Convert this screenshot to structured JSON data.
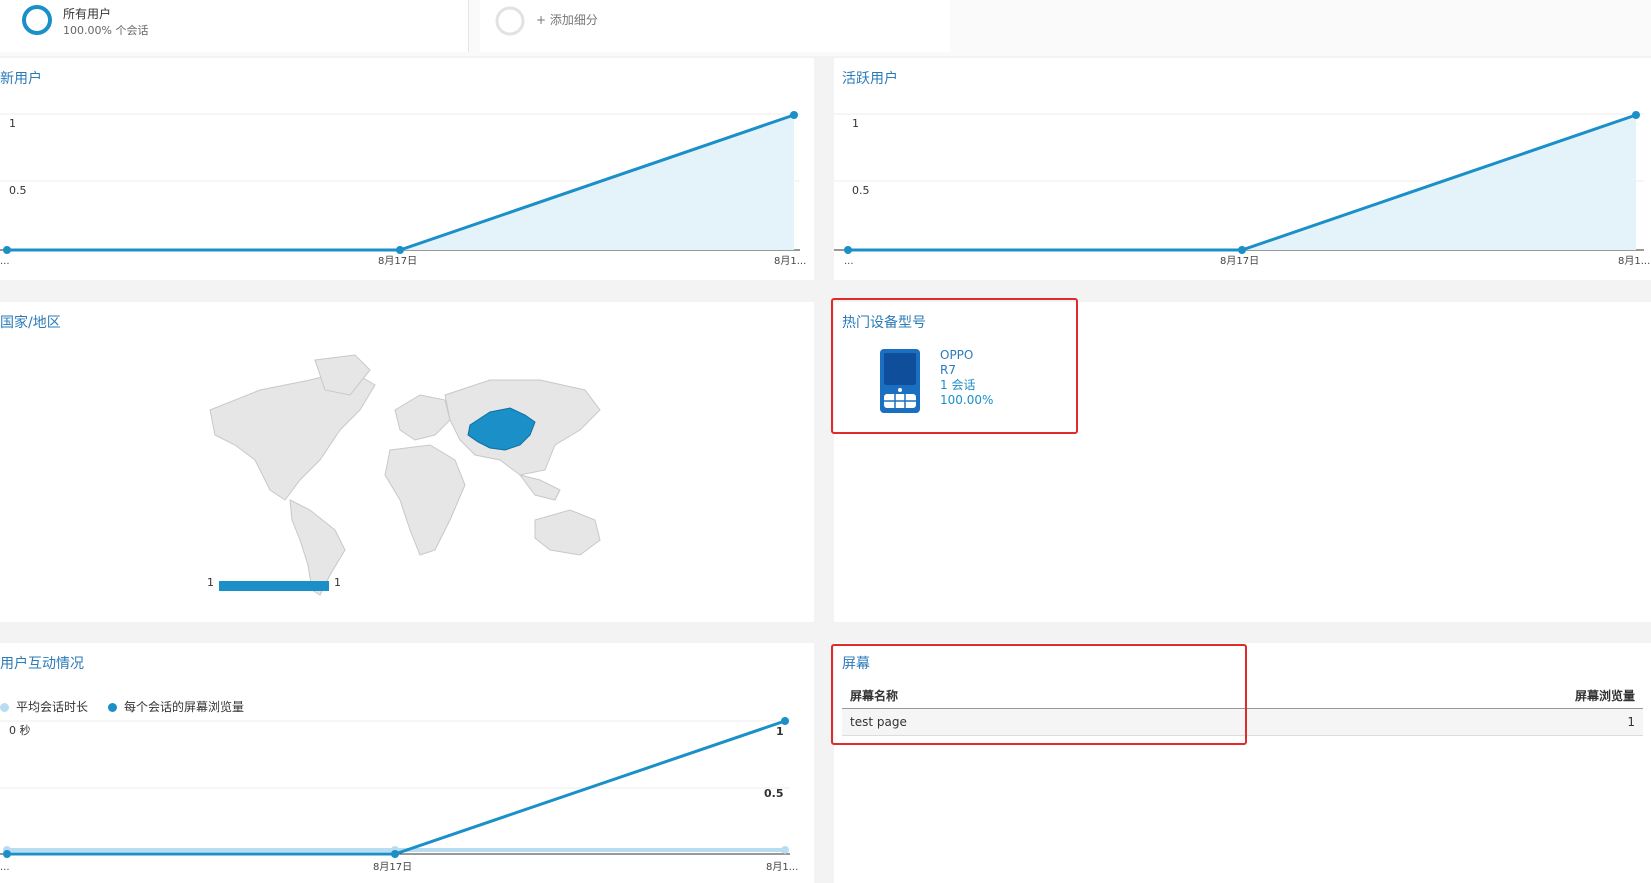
{
  "segment_bar": {
    "all_users_title": "所有用户",
    "all_users_sub": "100.00% 个会话",
    "add_segment": "+ 添加细分"
  },
  "colors": {
    "accent": "#1a8fc8",
    "accent_light": "#b8dcf0",
    "area_fill": "#e4f2fa",
    "title_blue": "#2b7bb9",
    "highlight_red": "#e02b2b"
  },
  "new_users": {
    "title": "新用户",
    "y_ticks": [
      "1",
      "0.5"
    ],
    "x_labels": [
      "...",
      "8月17日",
      "8月1..."
    ],
    "chart_data": {
      "type": "area",
      "categories": [
        "...",
        "8月17日",
        "8月1..."
      ],
      "values": [
        0,
        0,
        1
      ],
      "ylim": [
        0,
        1
      ]
    }
  },
  "active_users": {
    "title": "活跃用户",
    "y_ticks": [
      "1",
      "0.5"
    ],
    "x_labels": [
      "...",
      "8月17日",
      "8月1..."
    ],
    "chart_data": {
      "type": "area",
      "categories": [
        "...",
        "8月17日",
        "8月1..."
      ],
      "values": [
        0,
        0,
        1
      ],
      "ylim": [
        0,
        1
      ]
    }
  },
  "country": {
    "title": "国家/地区",
    "legend_min": "1",
    "legend_max": "1",
    "highlighted_country": "China"
  },
  "top_devices": {
    "title": "热门设备型号",
    "icon": "phone-icon",
    "brand": "OPPO",
    "model": "R7",
    "sessions": "1 会话",
    "percent": "100.00%"
  },
  "engagement": {
    "title": "用户互动情况",
    "legend_a": "平均会话时长",
    "legend_b": "每个会话的屏幕浏览量",
    "y_left": "0 秒",
    "y_right_ticks": [
      "1",
      "0.5"
    ],
    "x_labels": [
      "...",
      "8月17日",
      "8月1..."
    ],
    "chart_data": {
      "type": "line",
      "categories": [
        "...",
        "8月17日",
        "8月1..."
      ],
      "series": [
        {
          "name": "平均会话时长",
          "values": [
            0,
            0,
            0
          ]
        },
        {
          "name": "每个会话的屏幕浏览量",
          "values": [
            0,
            0,
            1
          ]
        }
      ],
      "ylim": [
        0,
        1
      ]
    }
  },
  "screens": {
    "title": "屏幕",
    "col_name": "屏幕名称",
    "col_views": "屏幕浏览量",
    "rows": [
      {
        "name": "test page",
        "views": "1"
      }
    ]
  }
}
